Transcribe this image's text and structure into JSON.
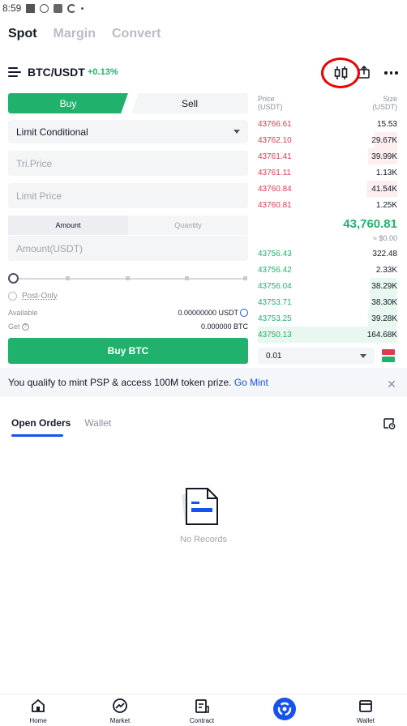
{
  "status_bar": {
    "time": "8:59"
  },
  "top_tabs": [
    {
      "label": "Spot",
      "active": true
    },
    {
      "label": "Margin",
      "active": false
    },
    {
      "label": "Convert",
      "active": false
    }
  ],
  "pair": {
    "name": "BTC/USDT",
    "change": "+0.13%"
  },
  "form": {
    "buy_label": "Buy",
    "sell_label": "Sell",
    "order_type": "Limit Conditional",
    "trigger_price_placeholder": "Tri.Price",
    "limit_price_placeholder": "Limit Price",
    "amount_tab": "Amount",
    "quantity_tab": "Quantity",
    "amount_placeholder": "Amount(USDT)",
    "post_only": "Post-Only",
    "available_label": "Available",
    "available_value": "0.00000000 USDT",
    "get_label": "Get",
    "get_value": "0.000000 BTC",
    "buy_button": "Buy BTC"
  },
  "orderbook": {
    "price_header": "Price",
    "price_unit": "(USDT)",
    "size_header": "Size",
    "size_unit": "(USDT)",
    "asks": [
      {
        "price": "43766.61",
        "size": "15.53"
      },
      {
        "price": "43762.10",
        "size": "29.67K"
      },
      {
        "price": "43761.41",
        "size": "39.99K"
      },
      {
        "price": "43761.11",
        "size": "1.13K"
      },
      {
        "price": "43760.84",
        "size": "41.54K"
      },
      {
        "price": "43760.81",
        "size": "1.25K"
      }
    ],
    "last_price": "43,760.81",
    "last_price_usd": "≈ $0.00",
    "bids": [
      {
        "price": "43756.43",
        "size": "322.48"
      },
      {
        "price": "43756.42",
        "size": "2.33K"
      },
      {
        "price": "43756.04",
        "size": "38.29K"
      },
      {
        "price": "43753.71",
        "size": "38.30K"
      },
      {
        "price": "43753.25",
        "size": "39.28K"
      },
      {
        "price": "43750.13",
        "size": "164.68K"
      }
    ],
    "precision": "0.01"
  },
  "banner": {
    "text": "You qualify to mint PSP & access 100M token prize. ",
    "link": "Go Mint"
  },
  "orders": {
    "tabs": [
      {
        "label": "Open Orders",
        "active": true
      },
      {
        "label": "Wallet",
        "active": false
      }
    ],
    "empty_text": "No Records"
  },
  "bottom_nav": [
    {
      "label": "Home"
    },
    {
      "label": "Market"
    },
    {
      "label": "Contract"
    },
    {
      "label": "Wallet"
    }
  ],
  "colors": {
    "buy_green": "#20b26c",
    "sell_red": "#e03b4e",
    "accent_blue": "#1652f0",
    "highlight_ring": "#ee0000"
  }
}
